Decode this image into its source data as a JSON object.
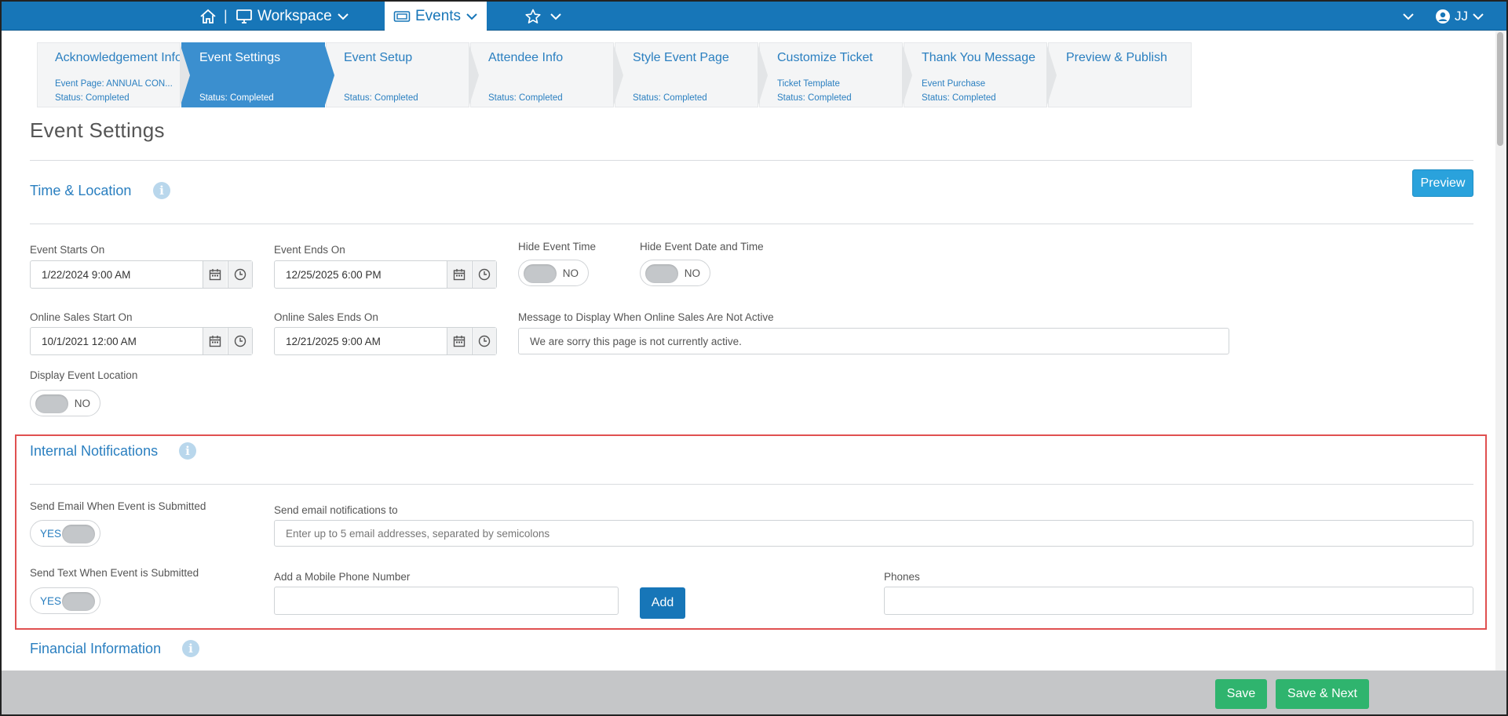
{
  "topnav": {
    "separator": "|",
    "workspace_label": "Workspace",
    "events_label": "Events",
    "user_initials": "JJ"
  },
  "steps": [
    {
      "title": "Acknowledgement Info",
      "sub1": "Event Page: ANNUAL CON...",
      "sub2": "Status: Completed",
      "active": false
    },
    {
      "title": "Event Settings",
      "sub1": "",
      "sub2": "Status: Completed",
      "active": true
    },
    {
      "title": "Event Setup",
      "sub1": "",
      "sub2": "Status: Completed",
      "active": false
    },
    {
      "title": "Attendee Info",
      "sub1": "",
      "sub2": "Status: Completed",
      "active": false
    },
    {
      "title": "Style Event Page",
      "sub1": "",
      "sub2": "Status: Completed",
      "active": false
    },
    {
      "title": "Customize Ticket",
      "sub1": "Ticket Template",
      "sub2": "Status: Completed",
      "active": false
    },
    {
      "title": "Thank You Message",
      "sub1": "Event Purchase",
      "sub2": "Status: Completed",
      "active": false
    },
    {
      "title": "Preview & Publish",
      "sub1": "",
      "sub2": "",
      "active": false
    }
  ],
  "page": {
    "title": "Event Settings"
  },
  "time_location": {
    "title": "Time & Location",
    "preview_label": "Preview",
    "event_starts_label": "Event Starts On",
    "event_starts_value": "1/22/2024 9:00 AM",
    "event_ends_label": "Event Ends On",
    "event_ends_value": "12/25/2025 6:00 PM",
    "hide_time_label": "Hide Event Time",
    "hide_time_value": "NO",
    "hide_date_time_label": "Hide Event Date and Time",
    "hide_date_time_value": "NO",
    "online_start_label": "Online Sales Start On",
    "online_start_value": "10/1/2021 12:00 AM",
    "online_end_label": "Online Sales Ends On",
    "online_end_value": "12/21/2025 9:00 AM",
    "message_label": "Message to Display When Online Sales Are Not Active",
    "message_value": "We are sorry this page is not currently active.",
    "display_location_label": "Display Event Location",
    "display_location_value": "NO"
  },
  "notifications": {
    "title": "Internal Notifications",
    "send_email_label": "Send Email When Event is Submitted",
    "send_email_value": "YES",
    "email_to_label": "Send email notifications to",
    "email_to_placeholder": "Enter up to 5 email addresses, separated by semicolons",
    "send_text_label": "Send Text When Event is Submitted",
    "send_text_value": "YES",
    "mobile_label": "Add a Mobile Phone Number",
    "add_label": "Add",
    "phones_label": "Phones"
  },
  "financial": {
    "title": "Financial Information"
  },
  "footer": {
    "save_label": "Save",
    "save_next_label": "Save & Next"
  },
  "colors": {
    "nav": "#1776b8",
    "accent": "#2a7fc0",
    "active_step": "#3b8fcf",
    "save_green": "#2fb46e",
    "highlight_red": "#e05050"
  }
}
